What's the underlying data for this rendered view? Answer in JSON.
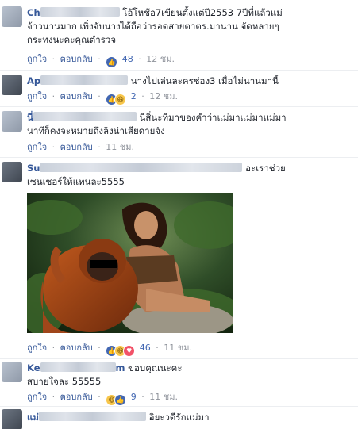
{
  "comments": [
    {
      "name": "Ch",
      "text_line1": "โอ้โหช้อ7เขียนตั้งแต่ปี2553 7ปีที่แล้วแม่",
      "text_line2": "จ้าวนานมาก เพิ่งจับนางได้ถือว่ารอดสายตาตร.มานาน จัดหลายๆ",
      "text_line3": "กระทงนะคะคุณตำรวจ",
      "like_label": "ถูกใจ",
      "reply_label": "ตอบกลับ",
      "reactions": [
        "like"
      ],
      "count": "48",
      "time": "12 ชม."
    },
    {
      "name": "Ap",
      "text_line1": "นางไปเล่นละครช่อง3 เมื่อไม่นานมานี้",
      "like_label": "ถูกใจ",
      "reply_label": "ตอบกลับ",
      "reactions": [
        "like",
        "haha"
      ],
      "count": "2",
      "time": "12 ชม."
    },
    {
      "name": "นี่",
      "text_line1": "นี่สิ่นะที่มาของคำว่าแม่มาแม่มาแม่มา",
      "text_line2": "นาทีก็คงจะหมายถึงลิงน่าเสียดายจัง",
      "like_label": "ถูกใจ",
      "reply_label": "ตอบกลับ",
      "time": "11 ชม."
    },
    {
      "name": "Su",
      "text_line1": "อะเราช่วย",
      "text_line2": "เซนเซอร์ให้แทนละ5555",
      "like_label": "ถูกใจ",
      "reply_label": "ตอบกลับ",
      "reactions": [
        "like",
        "haha",
        "love"
      ],
      "count": "46",
      "time": "11 ชม."
    },
    {
      "name": "Ke",
      "name_tail": "m",
      "text_line1": "ขอบคุณนะคะ",
      "text_line2": "สบายใจละ 55555",
      "like_label": "ถูกใจ",
      "reply_label": "ตอบกลับ",
      "reactions": [
        "haha",
        "like"
      ],
      "count": "9",
      "time": "11 ชม."
    },
    {
      "name": "แม่",
      "text_line1": "อิยะวดีรักแม่มา"
    }
  ],
  "colors": {
    "link": "#365899",
    "like_blue": "#4267b2",
    "meta_gray": "#90949c"
  },
  "icons": {
    "like": "thumbs-up-icon",
    "haha": "haha-face-icon",
    "love": "heart-icon"
  }
}
